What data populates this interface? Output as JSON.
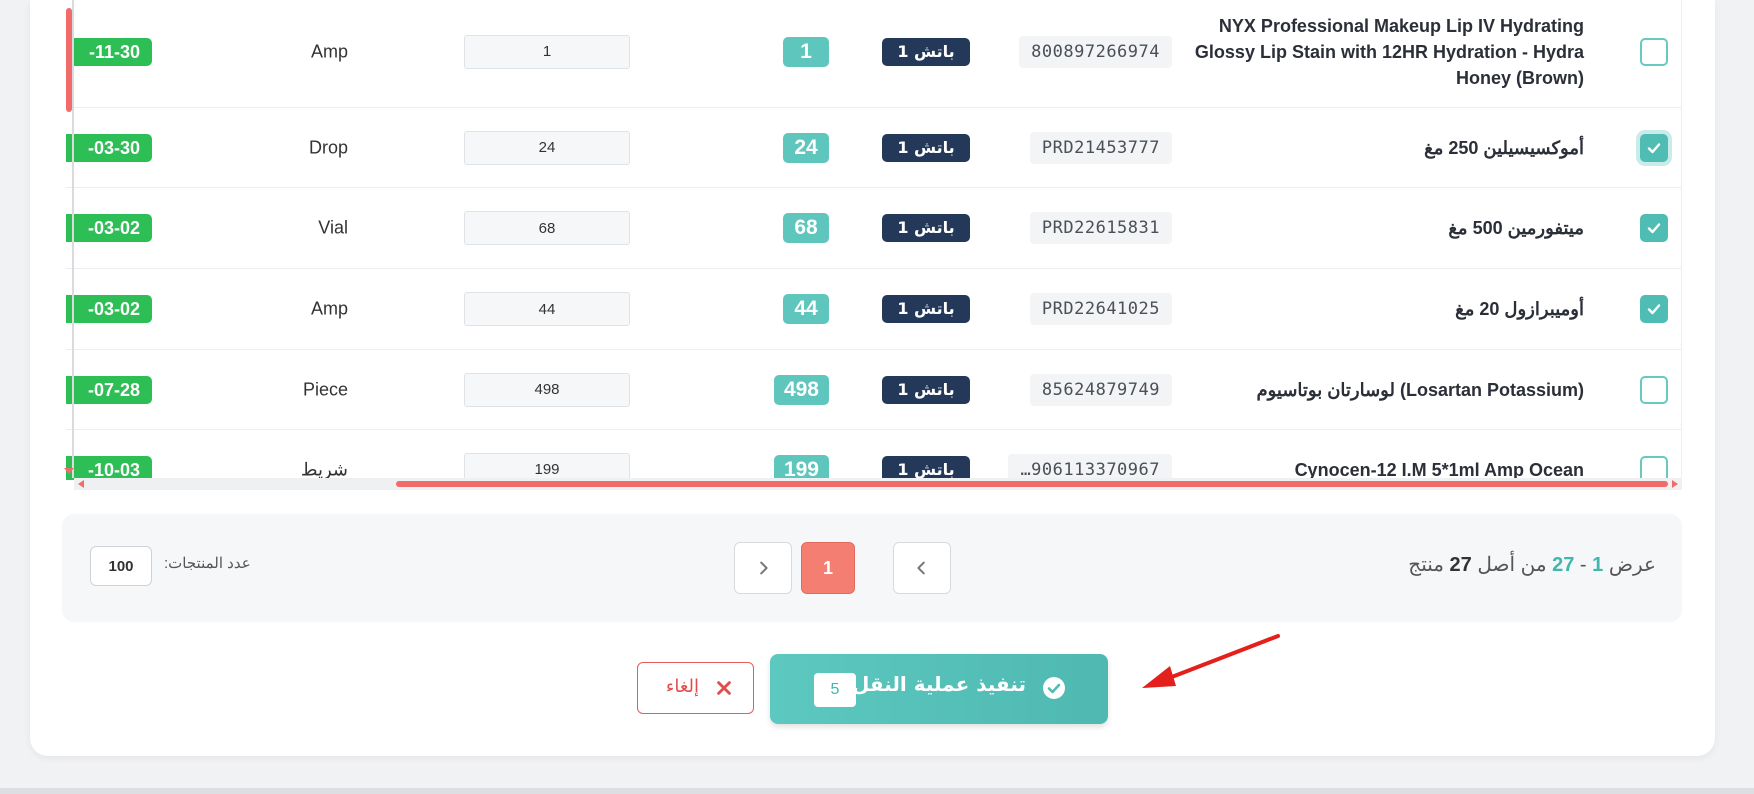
{
  "rows": [
    {
      "name": "NYX Professional Makeup Lip IV Hydrating Glossy Lip Stain with 12HR Hydration - Hydra Honey (Brown)",
      "code": "800897266974",
      "batch": "1 باتش",
      "qty": "1",
      "input": "1",
      "unit": "Amp",
      "date": "-11-30",
      "checked": false
    },
    {
      "name": "أموكسيسيلين 250 مغ",
      "code": "PRD21453777",
      "batch": "1 باتش",
      "qty": "24",
      "input": "24",
      "unit": "Drop",
      "date": "-03-30",
      "checked": true
    },
    {
      "name": "ميتفورمين 500 مغ",
      "code": "PRD22615831",
      "batch": "1 باتش",
      "qty": "68",
      "input": "68",
      "unit": "Vial",
      "date": "-03-02",
      "checked": true
    },
    {
      "name": "أوميبرازول 20 مغ",
      "code": "PRD22641025",
      "batch": "1 باتش",
      "qty": "44",
      "input": "44",
      "unit": "Amp",
      "date": "-03-02",
      "checked": true
    },
    {
      "name": "لوسارتان بوتاسيوم (Losartan Potassium)",
      "code": "85624879749",
      "batch": "1 باتش",
      "qty": "498",
      "input": "498",
      "unit": "Piece",
      "date": "-07-28",
      "checked": false
    },
    {
      "name": "Cynocen-12 I.M 5*1ml Amp Ocean",
      "code": "…906113370967",
      "batch": "1 باتش",
      "qty": "199",
      "input": "199",
      "unit": "شريط",
      "date": "-10-03",
      "checked": false
    }
  ],
  "pagination": {
    "showing_prefix": "عرض",
    "from": "1",
    "dash": "-",
    "to": "27",
    "of_text": "من أصل",
    "total": "27",
    "unit_text": "منتج",
    "current_page": "1",
    "per_page_label": "عدد المنتجات:",
    "per_page_value": "100"
  },
  "actions": {
    "execute_label": "تنفيذ عملية النقل",
    "execute_count": "5",
    "cancel_label": "إلغاء"
  },
  "colors": {
    "accent": "#4fbdb4",
    "danger": "#e24c4c",
    "batch": "#24395a",
    "date": "#2dbe55",
    "page_active": "#f47e72"
  }
}
